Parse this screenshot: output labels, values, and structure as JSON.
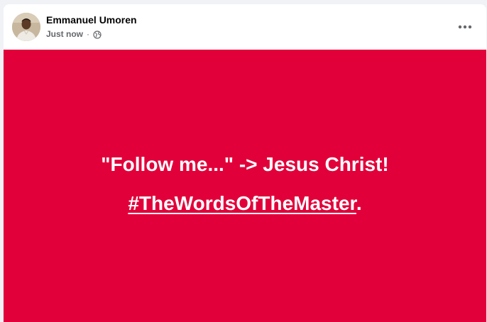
{
  "post": {
    "author": "Emmanuel Umoren",
    "timestamp": "Just now",
    "separator": "·",
    "audience_icon": "globe-icon",
    "more_icon": "more-options-icon",
    "background_color": "#e2003a",
    "text_line1": "\"Follow me...\" -> Jesus Christ!",
    "hashtag": "#TheWordsOfTheMaster",
    "hashtag_suffix": "."
  }
}
